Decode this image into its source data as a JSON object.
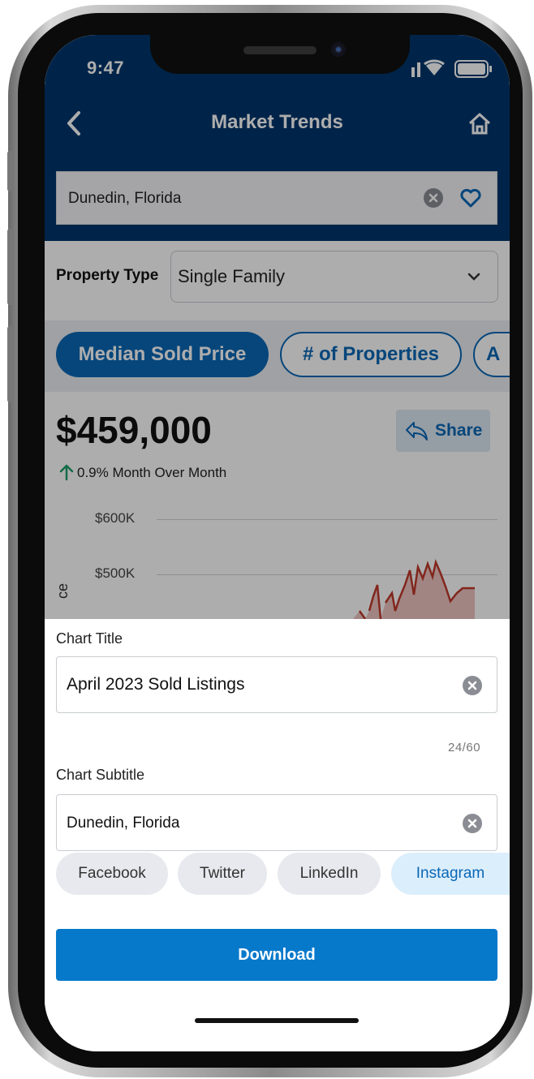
{
  "status": {
    "time": "9:47"
  },
  "nav": {
    "title": "Market Trends"
  },
  "search": {
    "value": "Dunedin, Florida"
  },
  "property_type": {
    "label": "Property Type",
    "selected": "Single Family"
  },
  "metric_chips": [
    {
      "label": "Median Sold Price",
      "active": true
    },
    {
      "label": "# of Properties",
      "active": false
    },
    {
      "label": "A",
      "active": false
    }
  ],
  "summary": {
    "price": "$459,000",
    "change_text": "0.9% Month Over Month",
    "change_direction": "up",
    "share_label": "Share"
  },
  "chart_data": {
    "type": "line",
    "y_ticks": [
      "$600K",
      "$500K"
    ],
    "ylabel_visible_fragment": "ce",
    "series_color": "#c0392b"
  },
  "sheet": {
    "chart_title_label": "Chart Title",
    "chart_title_value": "April 2023 Sold Listings",
    "chart_title_counter": "24/60",
    "chart_subtitle_label": "Chart Subtitle",
    "chart_subtitle_value": "Dunedin, Florida",
    "social": [
      {
        "label": "Facebook",
        "selected": false
      },
      {
        "label": "Twitter",
        "selected": false
      },
      {
        "label": "LinkedIn",
        "selected": false
      },
      {
        "label": "Instagram",
        "selected": true
      }
    ],
    "download_label": "Download"
  },
  "colors": {
    "nav_bg": "#00366c",
    "primary": "#0a67b5",
    "download": "#0779cb",
    "up_arrow": "#1e9e6a"
  }
}
